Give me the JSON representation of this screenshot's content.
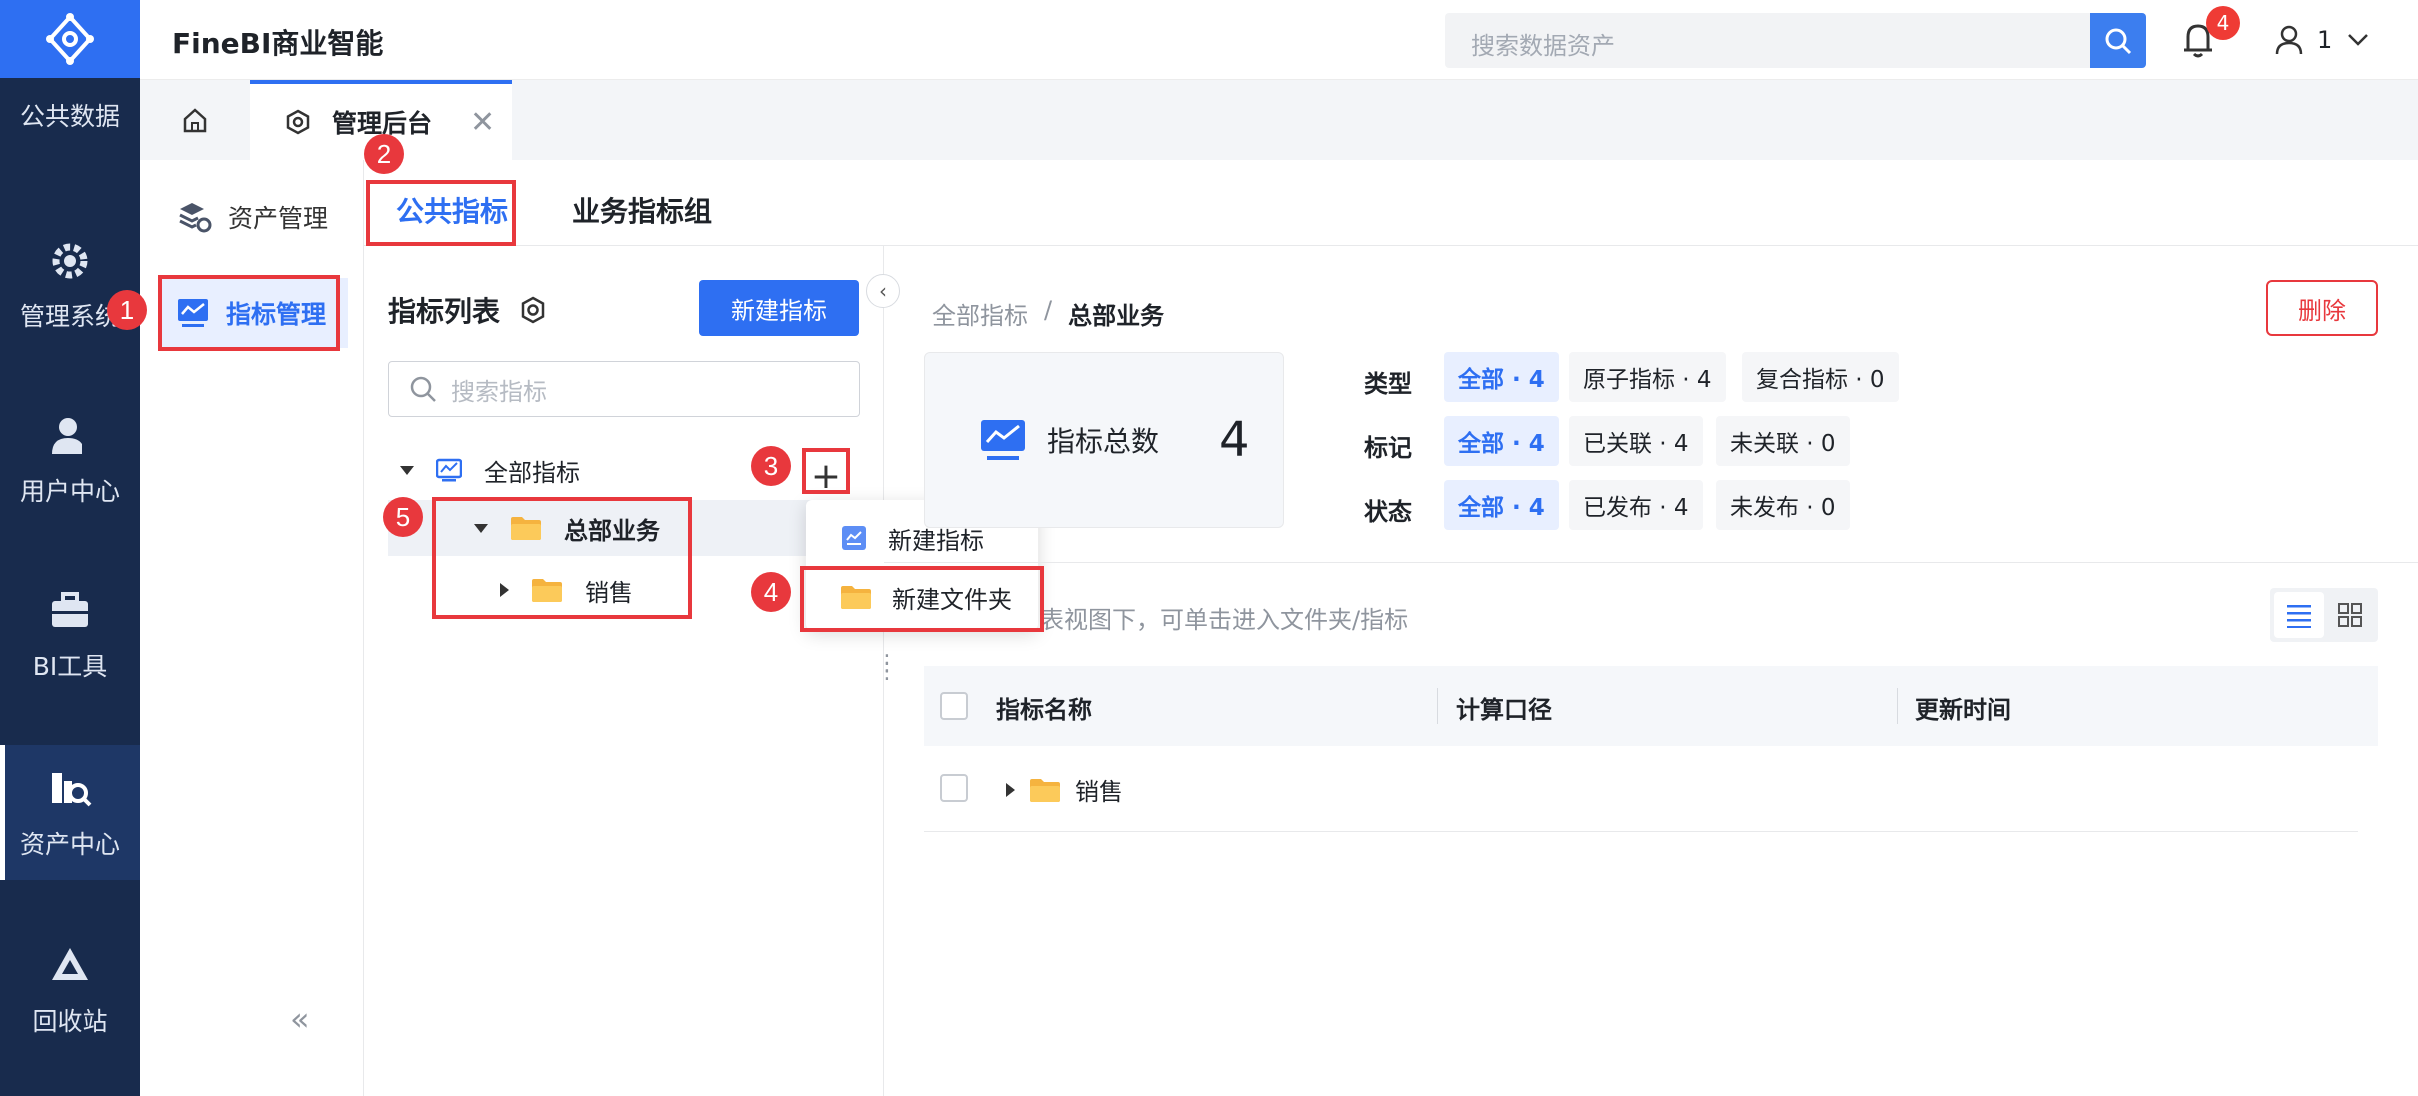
{
  "app": {
    "title": "FineBI商业智能"
  },
  "colors": {
    "brand": "#2e6ff2",
    "nav_bg": "#182b4d",
    "danger": "#e8383d",
    "folder": "#f5b33f"
  },
  "left_nav": {
    "items": [
      {
        "label": "公共数据",
        "icon": "database-icon"
      },
      {
        "label": "管理系统",
        "icon": "gear-icon"
      },
      {
        "label": "用户中心",
        "icon": "user-icon"
      },
      {
        "label": "BI工具",
        "icon": "toolbox-icon"
      },
      {
        "label": "资产中心",
        "icon": "asset-search-icon",
        "active": true
      },
      {
        "label": "回收站",
        "icon": "recycle-icon"
      }
    ]
  },
  "header": {
    "search_placeholder": "搜索数据资产",
    "notification_count": "4",
    "user_name": "1"
  },
  "tabs": {
    "admin_tab_label": "管理后台"
  },
  "submenu": {
    "items": [
      {
        "label": "资产管理"
      },
      {
        "label": "指标管理",
        "active": true
      }
    ]
  },
  "main_tabs": [
    {
      "label": "公共指标",
      "active": true
    },
    {
      "label": "业务指标组"
    }
  ],
  "list_panel": {
    "title": "指标列表",
    "new_button": "新建指标",
    "search_placeholder": "搜索指标",
    "tree": {
      "root": "全部指标",
      "folder": "总部业务",
      "subfolder": "销售"
    }
  },
  "popup": {
    "new_indicator": "新建指标",
    "new_folder": "新建文件夹"
  },
  "markers": [
    "1",
    "2",
    "3",
    "4",
    "5"
  ],
  "detail": {
    "breadcrumb": [
      "全部指标",
      "/",
      "总部业务"
    ],
    "delete_button": "删除",
    "stat": {
      "label": "指标总数",
      "value": "4"
    },
    "filters": [
      {
        "label": "类型",
        "chips": [
          "全部 · 4",
          "原子指标 · 4",
          "复合指标 · 0"
        ]
      },
      {
        "label": "标记",
        "chips": [
          "全部 · 4",
          "已关联 · 4",
          "未关联 · 0"
        ]
      },
      {
        "label": "状态",
        "chips": [
          "全部 · 4",
          "已发布 · 4",
          "未发布 · 0"
        ]
      }
    ],
    "hint": "表视图下，可单击进入文件夹/指标",
    "table": {
      "columns": [
        "指标名称",
        "计算口径",
        "更新时间"
      ],
      "rows": [
        {
          "name": "销售"
        }
      ]
    }
  }
}
